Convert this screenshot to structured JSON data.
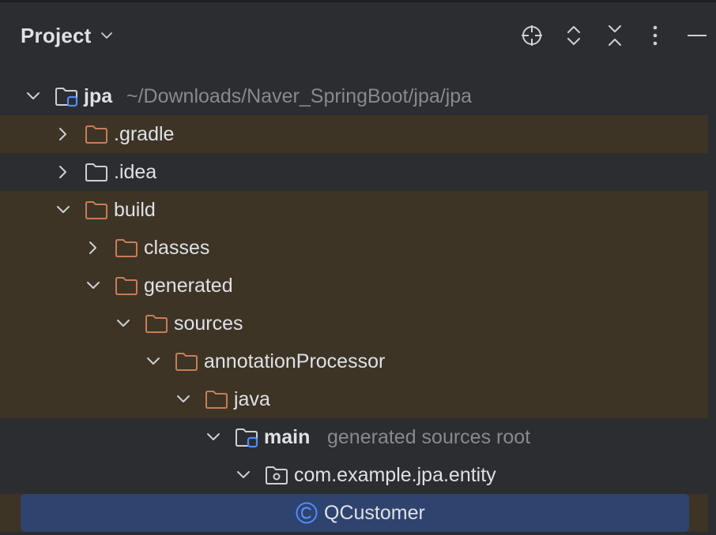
{
  "header": {
    "title": "Project",
    "icons": [
      "locate-icon",
      "expand-all-icon",
      "collapse-all-icon",
      "more-options-icon",
      "minimize-icon"
    ]
  },
  "tree": {
    "root": {
      "label": "jpa",
      "hint": "~/Downloads/Naver_SpringBoot/jpa/jpa"
    },
    "gradle": {
      "label": ".gradle"
    },
    "idea": {
      "label": ".idea"
    },
    "build": {
      "label": "build"
    },
    "classes": {
      "label": "classes"
    },
    "generated": {
      "label": "generated"
    },
    "sources": {
      "label": "sources"
    },
    "annotationProcessor": {
      "label": "annotationProcessor"
    },
    "java": {
      "label": "java"
    },
    "main": {
      "label": "main",
      "hint": "generated sources root"
    },
    "package": {
      "label": "com.example.jpa.entity"
    },
    "qcustomer": {
      "label": "QCustomer"
    }
  },
  "colors": {
    "background": "#2b2d30",
    "excluded_row": "#3d3426",
    "selection": "#2e436e",
    "folder_orange": "#c77d55",
    "folder_gray": "#ced0d6",
    "module_badge": "#548af7",
    "class_icon": "#548af7"
  }
}
